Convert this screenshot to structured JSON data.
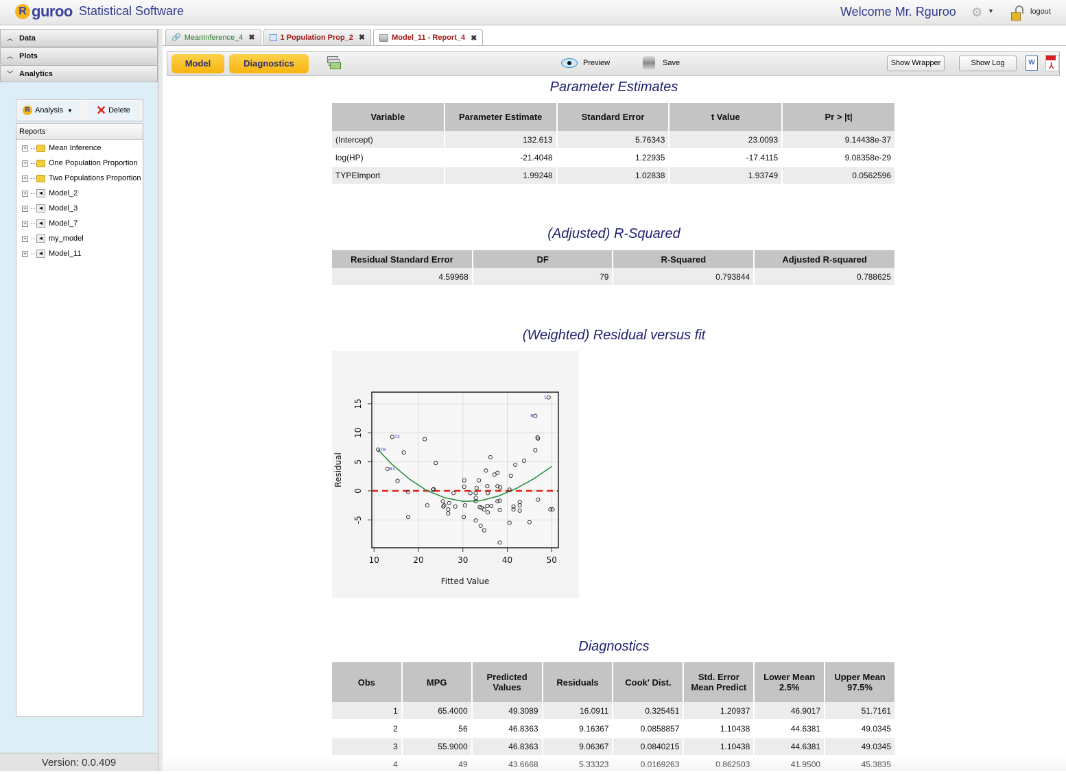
{
  "header": {
    "logo_text": "guroo",
    "logo_letter": "R",
    "app_title": "Statistical Software",
    "welcome": "Welcome Mr. Rguroo",
    "logout": "logout"
  },
  "sidebar": {
    "accordion": [
      {
        "label": "Data",
        "chevron": "^"
      },
      {
        "label": "Plots",
        "chevron": "^"
      },
      {
        "label": "Analytics",
        "chevron": "v"
      }
    ],
    "analysis_button": "Analysis",
    "delete_button": "Delete",
    "reports_header": "Reports",
    "tree": [
      {
        "label": "Mean Inference",
        "type": "folder"
      },
      {
        "label": "One Population Proportion",
        "type": "folder"
      },
      {
        "label": "Two Populations Proportion",
        "type": "folder"
      },
      {
        "label": "Model_2",
        "type": "model"
      },
      {
        "label": "Model_3",
        "type": "model"
      },
      {
        "label": "Model_7",
        "type": "model"
      },
      {
        "label": "my_model",
        "type": "model"
      },
      {
        "label": "Model_11",
        "type": "model"
      }
    ],
    "version": "Version: 0.0.409"
  },
  "tabs": [
    {
      "label": "MeanInference_4",
      "color": "#2a7a2a",
      "active": false
    },
    {
      "label": "1 Population Prop_2",
      "color": "#a01818",
      "active": false
    },
    {
      "label": "Model_11 - Report_4",
      "color": "#a01818",
      "active": true
    }
  ],
  "toolbar": {
    "model": "Model",
    "diagnostics": "Diagnostics",
    "preview": "Preview",
    "save": "Save",
    "show_wrapper": "Show Wrapper",
    "show_log": "Show Log",
    "word_icon": "W"
  },
  "parameter_estimates": {
    "title": "Parameter Estimates",
    "columns": [
      "Variable",
      "Parameter Estimate",
      "Standard Error",
      "t Value",
      "Pr > |t|"
    ],
    "rows": [
      [
        "(Intercept)",
        "132.613",
        "5.76343",
        "23.0093",
        "9.14438e-37"
      ],
      [
        "log(HP)",
        "-21.4048",
        "1.22935",
        "-17.4115",
        "9.08358e-29"
      ],
      [
        "TYPEImport",
        "1.99248",
        "1.02838",
        "1.93749",
        "0.0562596"
      ]
    ]
  },
  "r_squared": {
    "title": "(Adjusted) R-Squared",
    "columns": [
      "Residual Standard Error",
      "DF",
      "R-Squared",
      "Adjusted R-squared"
    ],
    "rows": [
      [
        "4.59968",
        "79",
        "0.793844",
        "0.788625"
      ]
    ]
  },
  "plot_title": "(Weighted) Residual versus fit",
  "chart_data": {
    "type": "scatter",
    "title": "(Weighted) Residual versus fit",
    "xlabel": "Fitted Value",
    "ylabel": "Residual",
    "xlim": [
      9.5,
      51.5
    ],
    "ylim": [
      -9.8,
      17
    ],
    "xticks": [
      10,
      20,
      30,
      40,
      50
    ],
    "yticks": [
      -5,
      0,
      5,
      10,
      15
    ],
    "grid": true,
    "reference_line": {
      "y": 0,
      "style": "dashed",
      "color": "#e8201a"
    },
    "smoother": {
      "color": "#1e8a3c",
      "points": [
        [
          10.9,
          7.1
        ],
        [
          14,
          4.6
        ],
        [
          18,
          2.0
        ],
        [
          22,
          0.0
        ],
        [
          26,
          -1.2
        ],
        [
          30,
          -1.8
        ],
        [
          34,
          -1.7
        ],
        [
          38,
          -0.9
        ],
        [
          42,
          0.4
        ],
        [
          46,
          2.1
        ],
        [
          50,
          4.2
        ]
      ]
    },
    "labeled_points": [
      {
        "x": 49.3,
        "y": 16.1,
        "label": "1"
      },
      {
        "x": 46.3,
        "y": 12.9,
        "label": "8"
      },
      {
        "x": 14.1,
        "y": 9.3,
        "label": "72"
      },
      {
        "x": 10.9,
        "y": 7.1,
        "label": "78"
      },
      {
        "x": 13.0,
        "y": 3.8,
        "label": "81"
      }
    ],
    "points": [
      [
        46.8,
        9.2
      ],
      [
        46.9,
        9.0
      ],
      [
        21.4,
        8.9
      ],
      [
        16.7,
        6.6
      ],
      [
        36.2,
        5.8
      ],
      [
        46.3,
        7.0
      ],
      [
        43.8,
        5.2
      ],
      [
        23.9,
        4.8
      ],
      [
        41.8,
        4.5
      ],
      [
        35.2,
        3.5
      ],
      [
        37.1,
        2.8
      ],
      [
        37.8,
        3.1
      ],
      [
        30.3,
        1.8
      ],
      [
        33.6,
        1.8
      ],
      [
        40.8,
        2.6
      ],
      [
        15.3,
        1.7
      ],
      [
        30.3,
        0.7
      ],
      [
        33.1,
        0.5
      ],
      [
        35.5,
        0.8
      ],
      [
        37.8,
        0.8
      ],
      [
        38.4,
        0.6
      ],
      [
        23.3,
        0.2
      ],
      [
        23.4,
        0.3
      ],
      [
        17.7,
        -0.2
      ],
      [
        27.9,
        -0.4
      ],
      [
        32.9,
        -0.4
      ],
      [
        35.6,
        -0.4
      ],
      [
        40.5,
        0.2
      ],
      [
        22.0,
        -2.5
      ],
      [
        25.5,
        -1.8
      ],
      [
        25.8,
        -2.5
      ],
      [
        26.9,
        -2.1
      ],
      [
        28.3,
        -2.7
      ],
      [
        26.7,
        -3.2
      ],
      [
        25.6,
        -2.7
      ],
      [
        30.5,
        -2.5
      ],
      [
        32.9,
        -1.8
      ],
      [
        33.8,
        -2.8
      ],
      [
        34.8,
        -3.2
      ],
      [
        35.5,
        -2.6
      ],
      [
        35.6,
        -3.7
      ],
      [
        37.8,
        -1.8
      ],
      [
        38.3,
        -3.3
      ],
      [
        41.4,
        -2.7
      ],
      [
        41.4,
        -3.2
      ],
      [
        42.8,
        -2.5
      ],
      [
        42.8,
        -1.9
      ],
      [
        42.8,
        -3.4
      ],
      [
        46.9,
        -1.5
      ],
      [
        49.7,
        -3.2
      ],
      [
        50.2,
        -3.2
      ],
      [
        26.7,
        -3.9
      ],
      [
        17.7,
        -4.5
      ],
      [
        30.2,
        -4.5
      ],
      [
        32.9,
        -5.1
      ],
      [
        34.0,
        -6.0
      ],
      [
        34.8,
        -6.8
      ],
      [
        40.5,
        -5.5
      ],
      [
        45.0,
        -5.4
      ],
      [
        38.3,
        -8.9
      ],
      [
        31.7,
        -0.4
      ],
      [
        32.9,
        -1.2
      ],
      [
        34.2,
        -2.9
      ],
      [
        36.4,
        -2.6
      ],
      [
        38.3,
        -1.7
      ]
    ]
  },
  "diagnostics": {
    "title": "Diagnostics",
    "columns": [
      "Obs",
      "MPG",
      "Predicted Values",
      "Residuals",
      "Cook' Dist.",
      "Std. Error Mean Predict",
      "Lower Mean 2.5%",
      "Upper Mean 97.5%"
    ],
    "rows": [
      [
        "1",
        "65.4000",
        "49.3089",
        "16.0911",
        "0.325451",
        "1.20937",
        "46.9017",
        "51.7161"
      ],
      [
        "2",
        "56",
        "46.8363",
        "9.16367",
        "0.0858857",
        "1.10438",
        "44.6381",
        "49.0345"
      ],
      [
        "3",
        "55.9000",
        "46.8363",
        "9.06367",
        "0.0840215",
        "1.10438",
        "44.6381",
        "49.0345"
      ],
      [
        "4",
        "49",
        "43.6668",
        "5.33323",
        "0.0169263",
        "0.862503",
        "41.9500",
        "45.3835"
      ]
    ]
  }
}
